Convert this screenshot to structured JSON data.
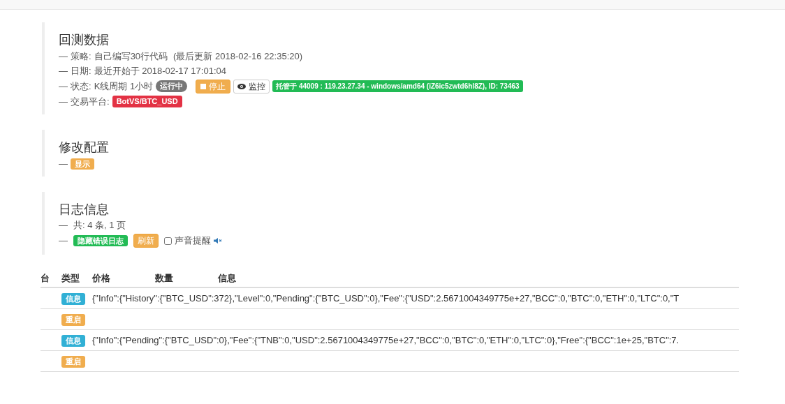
{
  "backtest": {
    "title": "回测数据",
    "strategy": {
      "dash": "—",
      "label": "策略:",
      "value": "自己编写30行代码",
      "updated": "(最后更新 2018-02-16 22:35:20)"
    },
    "date": {
      "dash": "—",
      "label": "日期:",
      "value": "最近开始于 2018-02-17 17:01:04"
    },
    "status": {
      "dash": "—",
      "label": "状态:",
      "value": "K线周期 1小时",
      "badge": "运行中",
      "stop_button": "停止",
      "monitor_button": "监控",
      "host": "托管于 44009 : 119.23.27.34 - windows/amd64 (iZ6ic5zwtd6hl8Z), ID: 73463"
    },
    "exchange": {
      "dash": "—",
      "label": "交易平台:",
      "badge": "BotVS/BTC_USD"
    }
  },
  "config": {
    "title": "修改配置",
    "dash": "—",
    "show_button": "显示"
  },
  "log": {
    "title": "日志信息",
    "summary_dash": "—",
    "controls_dash": "—",
    "summary": "共: 4 条, 1 页",
    "hide_errors_button": "隐藏错误日志",
    "refresh_button": "刷新",
    "sound_alert": {
      "label": "声音提醒",
      "checked": false
    }
  },
  "table": {
    "columns": [
      "台",
      "类型",
      "价格",
      "数量",
      "信息"
    ],
    "rows": [
      {
        "kind": "info",
        "type": "信息",
        "message": "{\"Info\":{\"History\":{\"BTC_USD\":372},\"Level\":0,\"Pending\":{\"BTC_USD\":0},\"Fee\":{\"USD\":2.5671004349775e+27,\"BCC\":0,\"BTC\":0,\"ETH\":0,\"LTC\":0,\"T"
      },
      {
        "kind": "restart",
        "type": "重启"
      },
      {
        "kind": "info",
        "type": "信息",
        "message": "{\"Info\":{\"Pending\":{\"BTC_USD\":0},\"Fee\":{\"TNB\":0,\"USD\":2.5671004349775e+27,\"BCC\":0,\"BTC\":0,\"ETH\":0,\"LTC\":0},\"Free\":{\"BCC\":1e+25,\"BTC\":7."
      },
      {
        "kind": "restart",
        "type": "重启"
      }
    ]
  }
}
